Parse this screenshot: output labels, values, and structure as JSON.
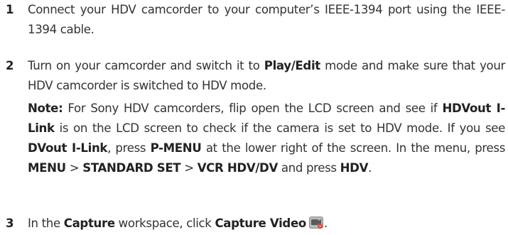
{
  "steps": [
    {
      "number": "1",
      "text": "Connect your HDV camcorder to your computer’s IEEE-1394 port using the IEEE-1394 cable."
    },
    {
      "number": "2",
      "t1": "Turn on your camcorder and switch it to ",
      "b1": "Play/Edit",
      "t2": " mode and make sure that your HDV camcorder is switched to HDV mode.",
      "note": {
        "label": "Note:",
        "t1": " For Sony HDV camcorders, flip open the LCD screen and see if ",
        "b1": "HDVout I-Link",
        "t2": " is on the LCD screen to check if the camera is set to HDV mode. If you see ",
        "b2": "DVout I-Link",
        "t3": ", press ",
        "b3": "P-MENU",
        "t4": " at the lower right of the screen. In the menu, press ",
        "b4": "MENU",
        "t5": " > ",
        "b5": "STANDARD SET",
        "t6": " > ",
        "b6": "VCR HDV/DV",
        "t7": " and press ",
        "b7": "HDV",
        "t8": "."
      }
    },
    {
      "number": "3",
      "t1": "In the ",
      "b1": "Capture",
      "t2": " workspace, click ",
      "b2": "Capture Video",
      "icon": "capture-video-icon"
    }
  ]
}
